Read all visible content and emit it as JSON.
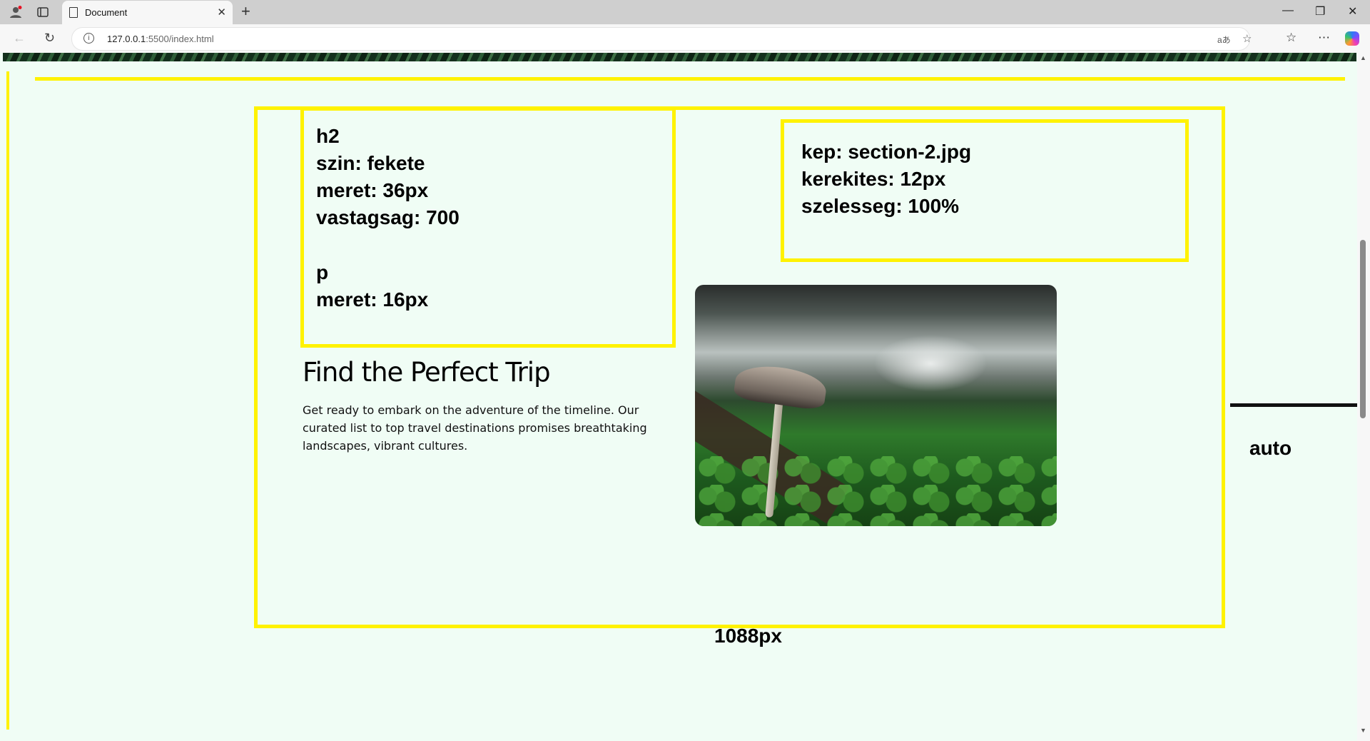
{
  "browser": {
    "tab_title": "Document",
    "new_tab_symbol": "+",
    "url_host": "127.0.0.1",
    "url_path": ":5500/index.html"
  },
  "annotations": {
    "text_box_lines": [
      "h2",
      "szin: fekete",
      "meret: 36px",
      "vastagsag: 700",
      "",
      "p",
      "meret: 16px"
    ],
    "image_box_lines": [
      "kep: section-2.jpg",
      "kerekites: 12px",
      "szelesseg: 100%"
    ],
    "auto_label": "auto",
    "width_label": "1088px",
    "guide_color": "#fff200"
  },
  "section": {
    "heading": "Find the Perfect Trip",
    "paragraph": "Get ready to embark on the adventure of the timeline. Our curated list to top travel destinations promises breathtaking landscapes, vibrant cultures.",
    "image_alt": "mushroom on mossy forest floor"
  },
  "icons": [
    "profile-icon",
    "tab-actions-icon",
    "page-icon",
    "close-icon",
    "new-tab-icon",
    "minimize-icon",
    "restore-icon",
    "close-window-icon",
    "back-icon",
    "refresh-icon",
    "info-icon",
    "read-aloud-icon",
    "favorite-icon",
    "favorites-icon",
    "more-icon",
    "copilot-icon"
  ]
}
